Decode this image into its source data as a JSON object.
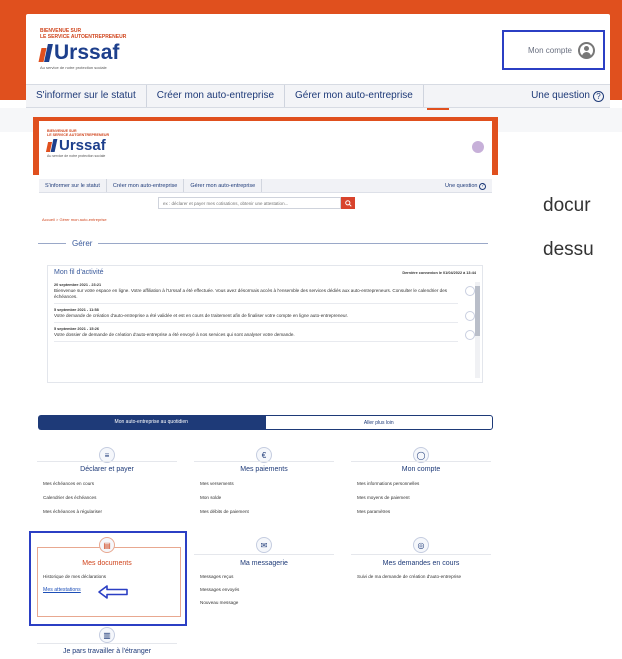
{
  "brand": {
    "tagline_line1": "BIENVENUE SUR",
    "tagline_line2": "LE SERVICE AUTOENTREPRENEUR",
    "logo_text": "Urssaf",
    "subtitle": "Au service de notre protection sociale"
  },
  "header": {
    "account_label": "Mon compte",
    "nav": [
      "S'informer sur le statut",
      "Créer mon auto-entreprise",
      "Gérer mon auto-entreprise"
    ],
    "help_label": "Une question",
    "help_icon": "?"
  },
  "search": {
    "placeholder": "ex : déclarer et payer mes cotisations, obtenir une attestation..."
  },
  "breadcrumb": "Accueil > Gérer mon auto-entreprise",
  "section_title": "Gérer",
  "activity": {
    "title": "Mon fil d'activité",
    "last_login": "Dernière connexion le 01/04/2022 à 13:44",
    "items": [
      {
        "date": "20 septembre 2021 - 23:21",
        "text": "Bienvenue sur votre espace en ligne. Votre affiliation à l'Urssaf a été effectuée. Vous avez désormais accès à l'ensemble des services dédiés aux auto-entrepreneurs. Consulter le calendrier des échéances."
      },
      {
        "date": "5 septembre 2021 - 11:58",
        "text": "Votre demande de création d'auto-entreprise a été validée et est en cours de traitement afin de finaliser votre compte en ligne auto-entrepreneur."
      },
      {
        "date": "5 septembre 2021 - 15:26",
        "text": "Votre dossier de demande de création d'auto-entreprise a été envoyé à nos services qui sont analyser votre demande."
      }
    ]
  },
  "tabs": [
    {
      "label": "Mon auto-entreprise au quotidien"
    },
    {
      "label": "Aller plus loin"
    }
  ],
  "services": {
    "declarer": {
      "title": "Déclarer et payer",
      "icon": "≡",
      "links": [
        "Mes échéances en cours",
        "Calendrier des échéances",
        "Mes échéances à régulariser"
      ]
    },
    "paiements": {
      "title": "Mes paiements",
      "icon": "€",
      "links": [
        "Mes versements",
        "Mon solde",
        "Mes débits de paiement"
      ]
    },
    "compte": {
      "title": "Mon compte",
      "icon": "◯",
      "links": [
        "Mes informations personnelles",
        "Mes moyens de paiement",
        "Mes paramètres"
      ]
    },
    "documents": {
      "title": "Mes documents",
      "icon": "▤",
      "links": [
        "Historique de mes déclarations",
        "Mes attestations"
      ]
    },
    "messagerie": {
      "title": "Ma messagerie",
      "icon": "✉",
      "links": [
        "Messages reçus",
        "Messages envoyés",
        "Nouveau message"
      ]
    },
    "demandes": {
      "title": "Mes demandes en cours",
      "icon": "◎",
      "links": [
        "Suivi de ma demande de création d'auto-entreprise"
      ]
    },
    "etranger": {
      "title": "Je pars travailler à l'étranger",
      "icon": "▥"
    }
  },
  "side_text": {
    "line1": "docur",
    "line2": "dessu"
  },
  "colors": {
    "brand_orange": "#e0501e",
    "brand_blue": "#1e3a78",
    "highlight_blue": "#2b3fc4"
  }
}
